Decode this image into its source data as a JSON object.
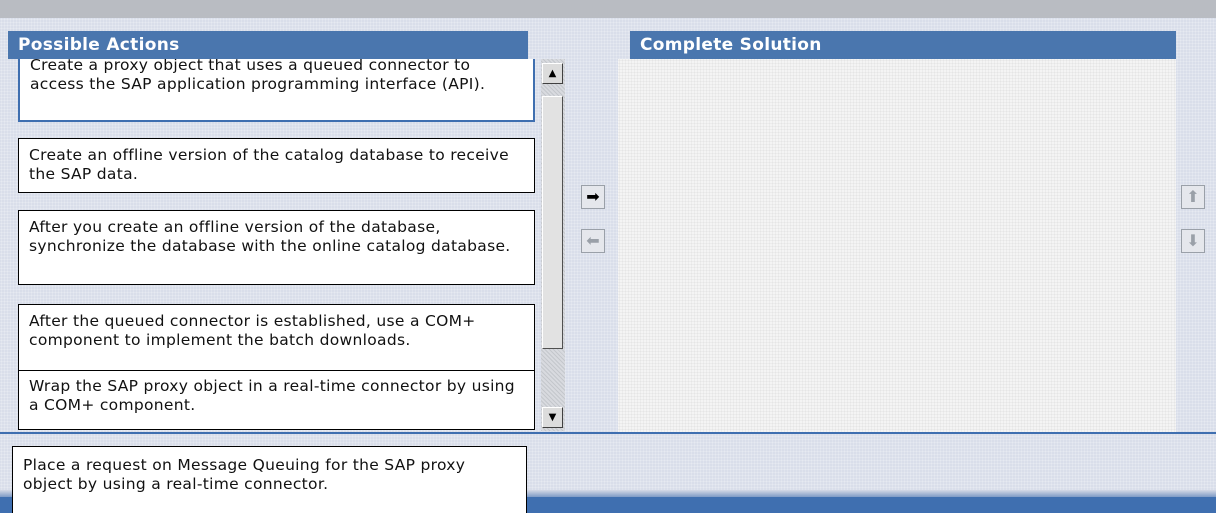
{
  "left_panel": {
    "title": "Possible Actions"
  },
  "right_panel": {
    "title": "Complete Solution"
  },
  "actions": [
    {
      "text": "Create a proxy object that uses a queued connector to access the SAP application programming interface (API)."
    },
    {
      "text": "Create an offline version of the catalog database to receive the SAP data."
    },
    {
      "text": "After you create an offline version of the database, synchronize the database with the online catalog database."
    },
    {
      "text": "After the queued connector is established, use a COM+ component to implement the batch downloads."
    },
    {
      "text": "Wrap the SAP proxy object in a real-time connector by using a COM+ component."
    }
  ],
  "dragging_action": {
    "text": "Place a request on Message Queuing for the SAP proxy object by using a real-time connector."
  },
  "icons": {
    "move_right": "arrow-right-icon",
    "move_left": "arrow-left-icon",
    "move_up": "arrow-up-icon",
    "move_down": "arrow-down-icon",
    "scroll_up": "scroll-up-icon",
    "scroll_down": "scroll-down-icon"
  },
  "colors": {
    "header": "#4a76ae",
    "accent_line": "#3f6fb0"
  }
}
